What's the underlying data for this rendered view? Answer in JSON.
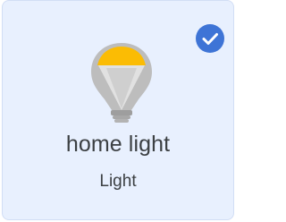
{
  "device": {
    "name": "home light",
    "type": "Light",
    "selected": true,
    "state": "on"
  },
  "icons": {
    "status": "check-circle-icon",
    "device": "lightbulb-icon"
  },
  "colors": {
    "card_background": "#e8f0fe",
    "card_border": "#d2def5",
    "check_fill": "#3e74d6",
    "bulb_glow": "#fbbc04",
    "bulb_glass": "#bdbdbd",
    "bulb_base": "#9e9e9e",
    "text": "#3c4043"
  }
}
